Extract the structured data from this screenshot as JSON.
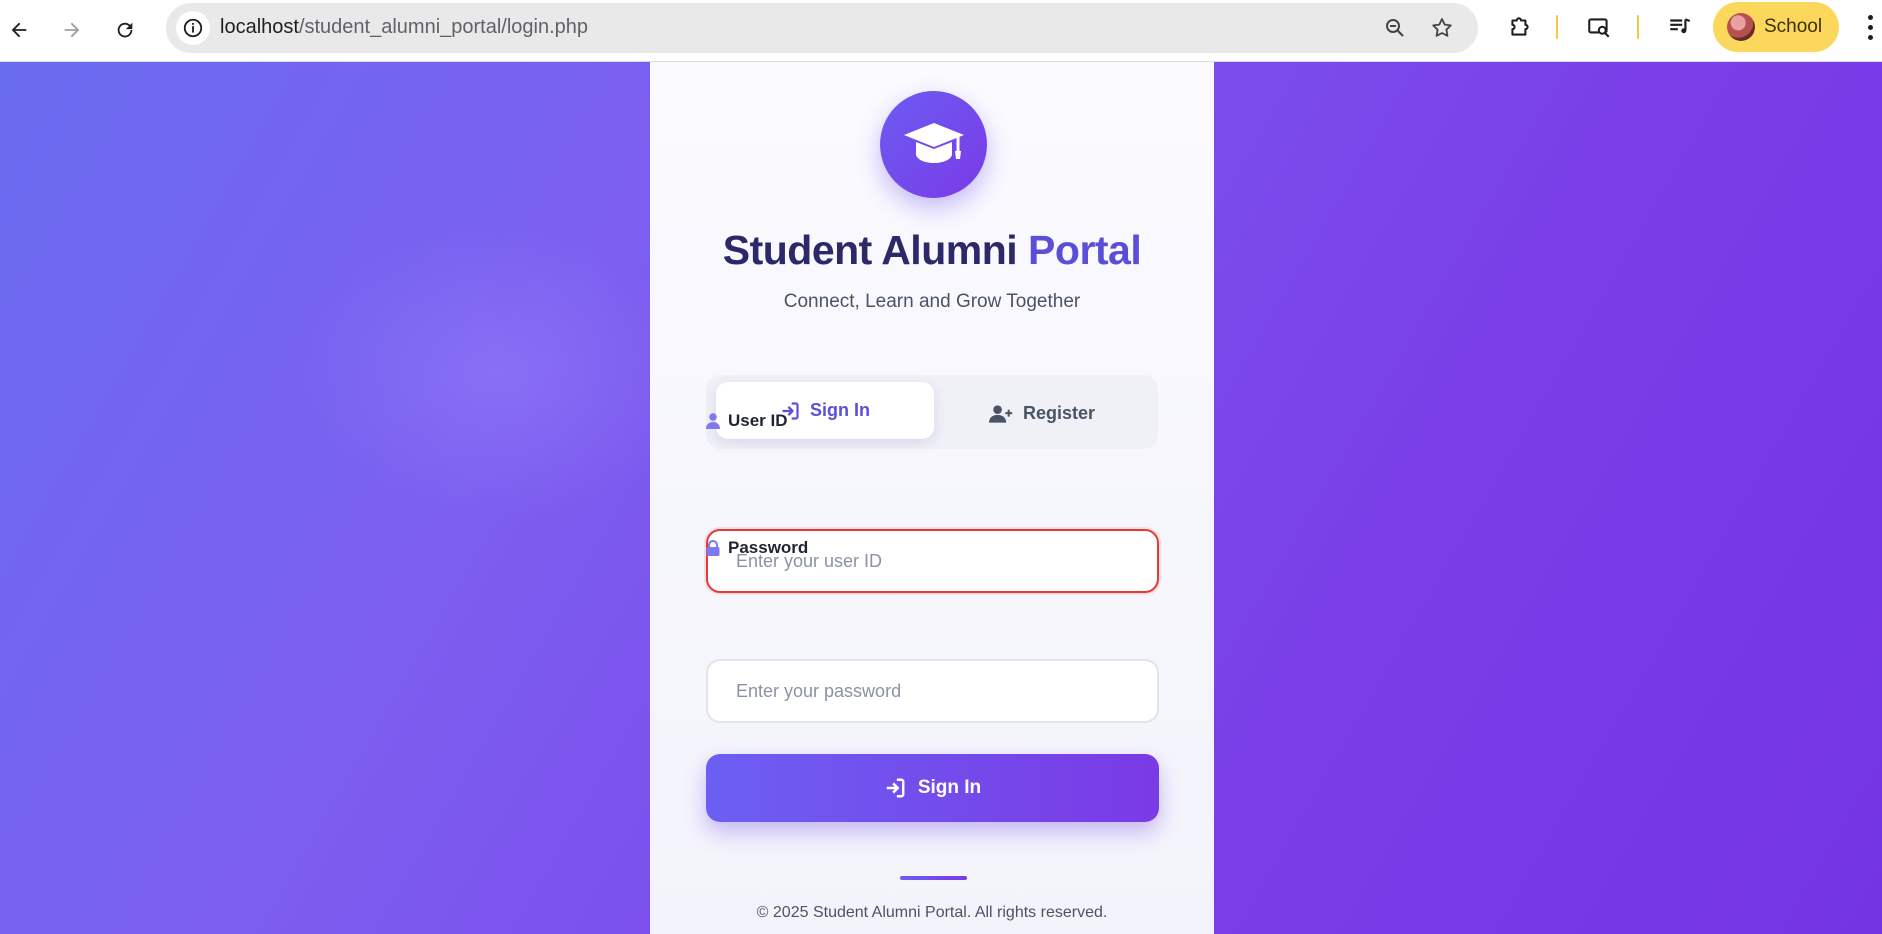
{
  "browser": {
    "url_host": "localhost",
    "url_path": "/student_alumni_portal/login.php",
    "profile_name": "School",
    "icons": [
      "back-arrow-icon",
      "forward-arrow-icon",
      "reload-icon",
      "site-info-icon",
      "zoom-icon",
      "bookmark-star-icon",
      "extensions-icon",
      "google-lens-icon",
      "media-queue-icon",
      "menu-icon"
    ],
    "colors": {
      "profile_chip": "#fbd75b",
      "toolbar_separator": "#f5c842"
    }
  },
  "portal": {
    "title_part1": "Student",
    "title_part2": "Alumni",
    "title_part3": "Portal",
    "subtitle": "Connect, Learn and Grow Together",
    "logo_icon": "graduation-cap-icon",
    "colors": {
      "gradient_start": "#6a6cf0",
      "gradient_end": "#7434e4",
      "title_dark": "#2b2967",
      "accent": "#5b4fd8",
      "error_border": "#e53935"
    }
  },
  "tabs": [
    {
      "label": "Sign In",
      "icon": "sign-in-icon",
      "active": true
    },
    {
      "label": "Register",
      "icon": "user-plus-icon",
      "active": false
    }
  ],
  "form": {
    "user_id": {
      "label": "User ID",
      "icon": "user-icon",
      "placeholder": "Enter your user ID",
      "value": "",
      "state": "error"
    },
    "password": {
      "label": "Password",
      "icon": "lock-icon",
      "placeholder": "Enter your password",
      "value": ""
    },
    "submit_label": "Sign In",
    "submit_icon": "sign-in-icon"
  },
  "footer": "© 2025 Student Alumni Portal. All rights reserved."
}
